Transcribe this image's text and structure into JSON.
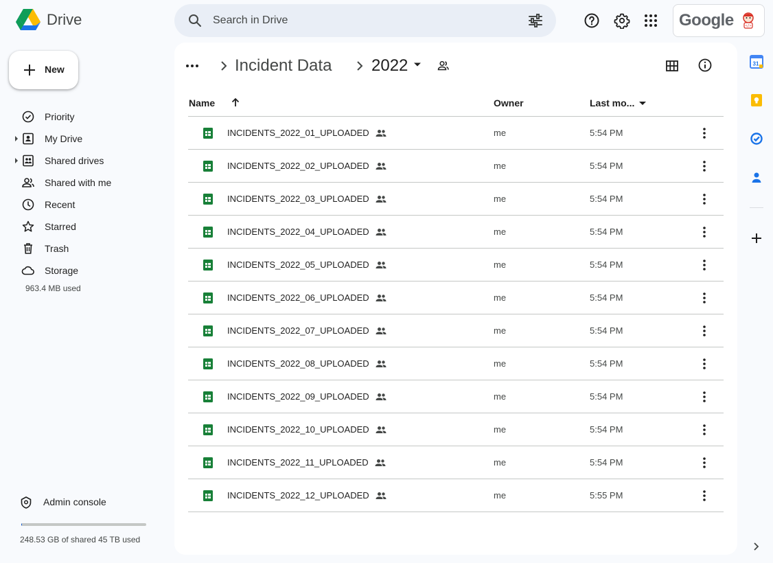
{
  "app": {
    "name": "Drive"
  },
  "search": {
    "placeholder": "Search in Drive"
  },
  "account": {
    "brand": "Google"
  },
  "sidebar": {
    "new_label": "New",
    "items": [
      {
        "label": "Priority",
        "icon": "priority-icon"
      },
      {
        "label": "My Drive",
        "icon": "my-drive-icon"
      },
      {
        "label": "Shared drives",
        "icon": "shared-drives-icon"
      },
      {
        "label": "Shared with me",
        "icon": "shared-with-me-icon"
      },
      {
        "label": "Recent",
        "icon": "clock-icon"
      },
      {
        "label": "Starred",
        "icon": "star-icon"
      },
      {
        "label": "Trash",
        "icon": "trash-icon"
      },
      {
        "label": "Storage",
        "icon": "cloud-icon"
      }
    ],
    "storage_used": "963.4 MB used",
    "admin_label": "Admin console",
    "quota_text": "248.53 GB of shared 45 TB used",
    "quota_fraction": 0.0055
  },
  "breadcrumb": {
    "parent": "Incident Data",
    "current": "2022"
  },
  "table": {
    "columns": {
      "name": "Name",
      "owner": "Owner",
      "modified": "Last mo..."
    },
    "rows": [
      {
        "name": "INCIDENTS_2022_01_UPLOADED",
        "owner": "me",
        "modified": "5:54 PM"
      },
      {
        "name": "INCIDENTS_2022_02_UPLOADED",
        "owner": "me",
        "modified": "5:54 PM"
      },
      {
        "name": "INCIDENTS_2022_03_UPLOADED",
        "owner": "me",
        "modified": "5:54 PM"
      },
      {
        "name": "INCIDENTS_2022_04_UPLOADED",
        "owner": "me",
        "modified": "5:54 PM"
      },
      {
        "name": "INCIDENTS_2022_05_UPLOADED",
        "owner": "me",
        "modified": "5:54 PM"
      },
      {
        "name": "INCIDENTS_2022_06_UPLOADED",
        "owner": "me",
        "modified": "5:54 PM"
      },
      {
        "name": "INCIDENTS_2022_07_UPLOADED",
        "owner": "me",
        "modified": "5:54 PM"
      },
      {
        "name": "INCIDENTS_2022_08_UPLOADED",
        "owner": "me",
        "modified": "5:54 PM"
      },
      {
        "name": "INCIDENTS_2022_09_UPLOADED",
        "owner": "me",
        "modified": "5:54 PM"
      },
      {
        "name": "INCIDENTS_2022_10_UPLOADED",
        "owner": "me",
        "modified": "5:54 PM"
      },
      {
        "name": "INCIDENTS_2022_11_UPLOADED",
        "owner": "me",
        "modified": "5:54 PM"
      },
      {
        "name": "INCIDENTS_2022_12_UPLOADED",
        "owner": "me",
        "modified": "5:55 PM"
      }
    ]
  },
  "rail": {
    "calendar_day": "31"
  },
  "colors": {
    "accent": "#0b57d0",
    "sheets_green": "#188038",
    "background": "#f8fafd",
    "search_bg": "#e9eef6"
  }
}
